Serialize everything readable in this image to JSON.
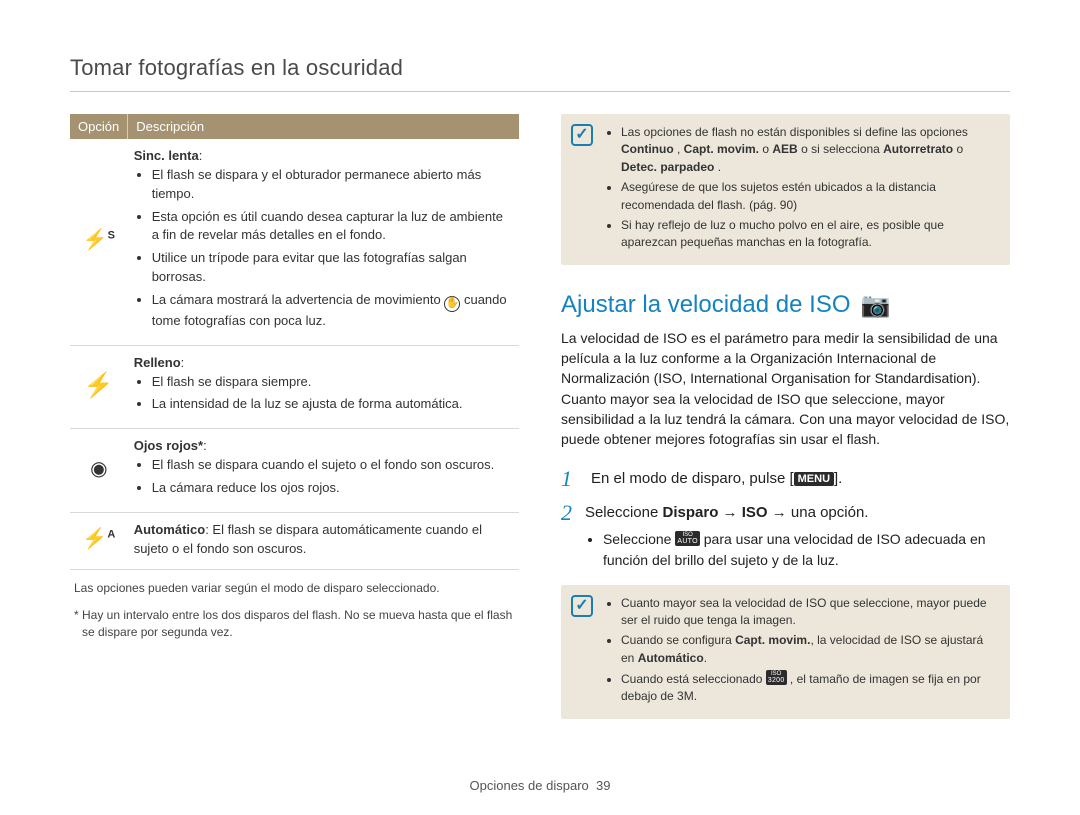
{
  "page_title": "Tomar fotografías en la oscuridad",
  "table": {
    "head_option": "Opción",
    "head_description": "Descripción",
    "row1_icon_base": "⚡",
    "row1_icon_sup": "S",
    "row1_name": "Sinc. lenta",
    "row1_colon": ":",
    "row1_b1": "El flash se dispara y el obturador permanece abierto más tiempo.",
    "row1_b2": "Esta opción es útil cuando desea capturar la luz de ambiente a fin de revelar más detalles en el fondo.",
    "row1_b3": "Utilice un trípode para evitar que las fotografías salgan borrosas.",
    "row1_b4a": "La cámara mostrará la advertencia de movimiento ",
    "row1_b4b": " cuando tome fotografías con poca luz.",
    "row1_hand_icon": "✋",
    "row2_icon": "⚡",
    "row2_name": "Relleno",
    "row2_colon": ":",
    "row2_b1": "El flash se dispara siempre.",
    "row2_b2": "La intensidad de la luz se ajusta de forma automática.",
    "row3_icon": "◉",
    "row3_name": "Ojos rojos*",
    "row3_colon": ":",
    "row3_b1": "El flash se dispara cuando el sujeto o el fondo son oscuros.",
    "row3_b2": "La cámara reduce los ojos rojos.",
    "row4_icon_base": "⚡",
    "row4_icon_sup": "A",
    "row4_strong": "Automático",
    "row4_rest": ": El flash se dispara automáticamente cuando el sujeto o el fondo son oscuros."
  },
  "footnotes": {
    "l1": "Las opciones pueden variar según el modo de disparo seleccionado.",
    "l2": "* Hay un intervalo entre los dos disparos del flash. No se mueva hasta que el flash se dispare por segunda vez."
  },
  "note1": {
    "icon": "✓",
    "b1a": "Las opciones de flash no están disponibles si define las opciones ",
    "b1_bold1": "Continuo",
    "b1b": ", ",
    "b1_bold2": "Capt. movim.",
    "b1c": " o ",
    "b1_bold3": "AEB",
    "b1d": " o si selecciona ",
    "b1_bold4": "Autorretrato",
    "b1e": " o ",
    "b1_bold5": "Detec. parpadeo",
    "b1f": ".",
    "b2": "Asegúrese de que los sujetos estén ubicados a la distancia recomendada del flash. (pág. 90)",
    "b3": "Si hay reflejo de luz o mucho polvo en el aire, es posible que aparezcan pequeñas manchas en la fotografía."
  },
  "section_title": "Ajustar la velocidad de ISO",
  "section_mode_icon": "📷",
  "section_body": "La velocidad de ISO es el parámetro para medir la sensibilidad de una película a la luz conforme a la Organización Internacional de Normalización (ISO, International Organisation for Standardisation). Cuanto mayor sea la velocidad de ISO que seleccione, mayor sensibilidad a la luz tendrá la cámara. Con una mayor velocidad de ISO, puede obtener mejores fotografías sin usar el flash.",
  "steps": {
    "num1": "1",
    "s1a": "En el modo de disparo, pulse [",
    "s1_menu": "MENU",
    "s1b": "].",
    "num2": "2",
    "s2a": "Seleccione ",
    "s2_bold1": "Disparo",
    "s2_arrow1": " → ",
    "s2_bold2": "ISO",
    "s2_arrow2": " → una opción.",
    "s2_sub_a": "Seleccione ",
    "s2_sub_badge_top": "ISO",
    "s2_sub_badge_bot": "AUTO",
    "s2_sub_b": " para usar una velocidad de ISO adecuada en función del brillo del sujeto y de la luz."
  },
  "note2": {
    "icon": "✓",
    "b1": "Cuanto mayor sea la velocidad de ISO que seleccione, mayor puede ser el ruido que tenga la imagen.",
    "b2a": "Cuando se configura ",
    "b2_bold": "Capt. movim.",
    "b2b": ", la velocidad de ISO se ajustará en ",
    "b2_bold2": "Automático",
    "b2c": ".",
    "b3a": "Cuando está seleccionado ",
    "b3_badge_top": "ISO",
    "b3_badge_bot": "3200",
    "b3b": ", el tamaño de imagen se fija en por debajo de 3M."
  },
  "footer_label": "Opciones de disparo",
  "footer_page": "39"
}
